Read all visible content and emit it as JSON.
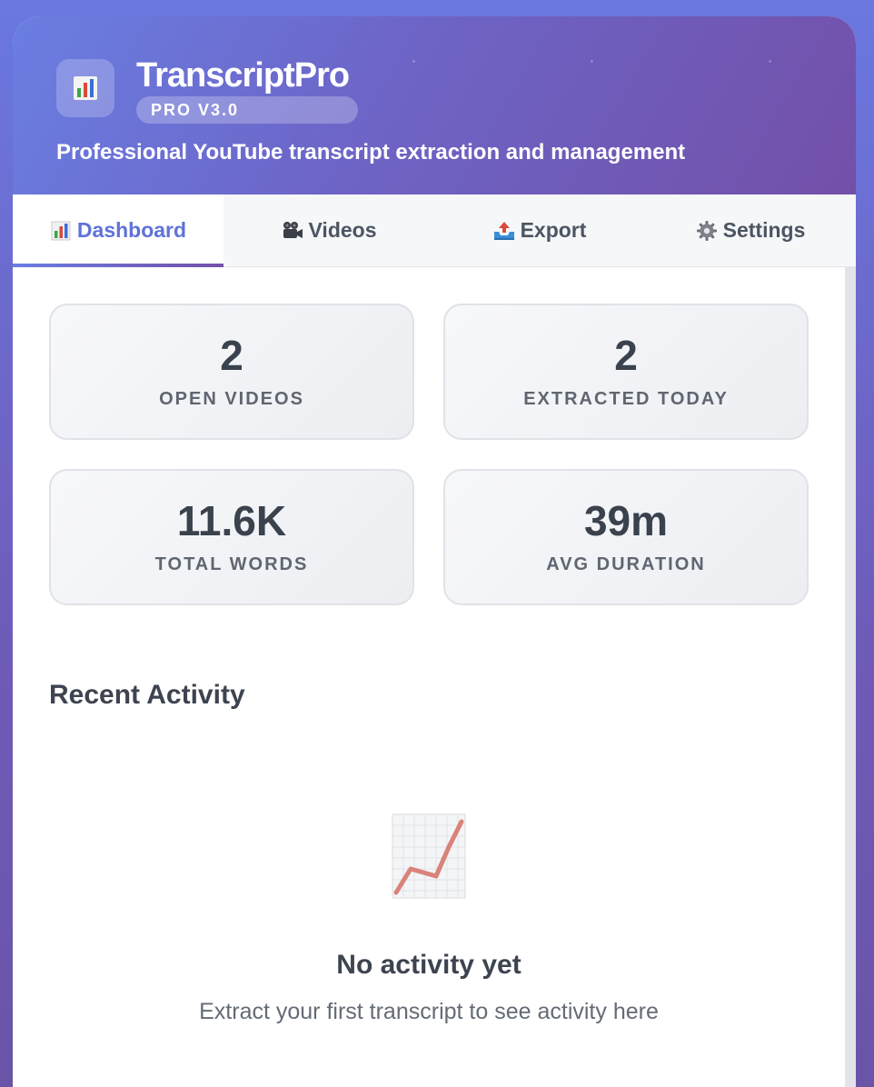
{
  "header": {
    "app_name": "TranscriptPro",
    "version_badge": "PRO V3.0",
    "tagline": "Professional YouTube transcript extraction and management",
    "logo_icon": "bar-chart-icon"
  },
  "tabs": [
    {
      "label": "Dashboard",
      "icon": "bar-chart-icon",
      "active": true
    },
    {
      "label": "Videos",
      "icon": "movie-camera-icon",
      "active": false
    },
    {
      "label": "Export",
      "icon": "outbox-tray-icon",
      "active": false
    },
    {
      "label": "Settings",
      "icon": "gear-icon",
      "active": false
    }
  ],
  "stats": [
    {
      "value": "2",
      "label": "OPEN VIDEOS"
    },
    {
      "value": "2",
      "label": "EXTRACTED TODAY"
    },
    {
      "value": "11.6K",
      "label": "TOTAL WORDS"
    },
    {
      "value": "39m",
      "label": "AVG DURATION"
    }
  ],
  "recent_activity": {
    "title": "Recent Activity",
    "empty_icon": "chart-increasing-icon",
    "empty_title": "No activity yet",
    "empty_subtitle": "Extract your first transcript to see activity here"
  },
  "colors": {
    "accent": "#5f72d8",
    "header_start": "#6a7ee2",
    "header_end": "#7350a8"
  }
}
